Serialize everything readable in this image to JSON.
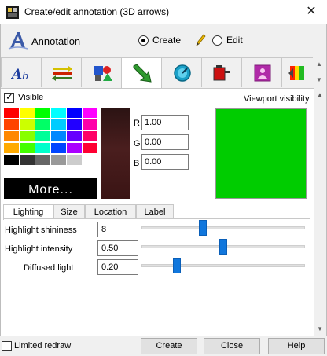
{
  "window": {
    "title": "Create/edit annotation (3D arrows)",
    "close_glyph": "✕"
  },
  "header": {
    "label": "Annotation",
    "mode_create": "Create",
    "mode_edit": "Edit",
    "selected_mode": "Create"
  },
  "tabs": [
    {
      "icon": "text-style-icon"
    },
    {
      "icon": "arrows-icon"
    },
    {
      "icon": "shapes-icon"
    },
    {
      "icon": "3d-arrow-icon",
      "active": true
    },
    {
      "icon": "gauge-icon"
    },
    {
      "icon": "battery-icon"
    },
    {
      "icon": "stamp-icon"
    },
    {
      "icon": "color-cube-icon"
    }
  ],
  "color_panel": {
    "visible_label": "Visible",
    "visible_checked": true,
    "viewport_visibility_label": "Viewport visibility",
    "more_label": "More...",
    "r_label": "R",
    "g_label": "G",
    "b_label": "B",
    "r_value": "1.00",
    "g_value": "0.00",
    "b_value": "0.00",
    "viewport_color": "#00cc00",
    "swatches": [
      [
        "#ff0000",
        "#ffff00",
        "#00ff00",
        "#00ffff",
        "#0000ff",
        "#ff00ff"
      ],
      [
        "#ff4400",
        "#ccff00",
        "#00ff66",
        "#00ccff",
        "#2200ff",
        "#ff00aa"
      ],
      [
        "#ff8800",
        "#88ff00",
        "#00ff99",
        "#0088ff",
        "#6600ff",
        "#ff0066"
      ],
      [
        "#ffaa00",
        "#44ff00",
        "#00ffcc",
        "#0044ff",
        "#aa00ff",
        "#ff0033"
      ],
      [
        "#000000",
        "#333333",
        "#666666",
        "#999999",
        "#cccccc",
        "#ffffff"
      ]
    ]
  },
  "subtabs": [
    "Lighting",
    "Size",
    "Location",
    "Label"
  ],
  "active_subtab": "Lighting",
  "lighting": [
    {
      "label": "Highlight shininess",
      "value": "8",
      "level": 0.37
    },
    {
      "label": "Highlight intensity",
      "value": "0.50",
      "level": 0.5
    },
    {
      "label": "Diffused light",
      "value": "0.20",
      "level": 0.2
    }
  ],
  "footer": {
    "limited_redraw_label": "Limited redraw",
    "limited_redraw_checked": false,
    "create_label": "Create",
    "close_label": "Close",
    "help_label": "Help"
  }
}
